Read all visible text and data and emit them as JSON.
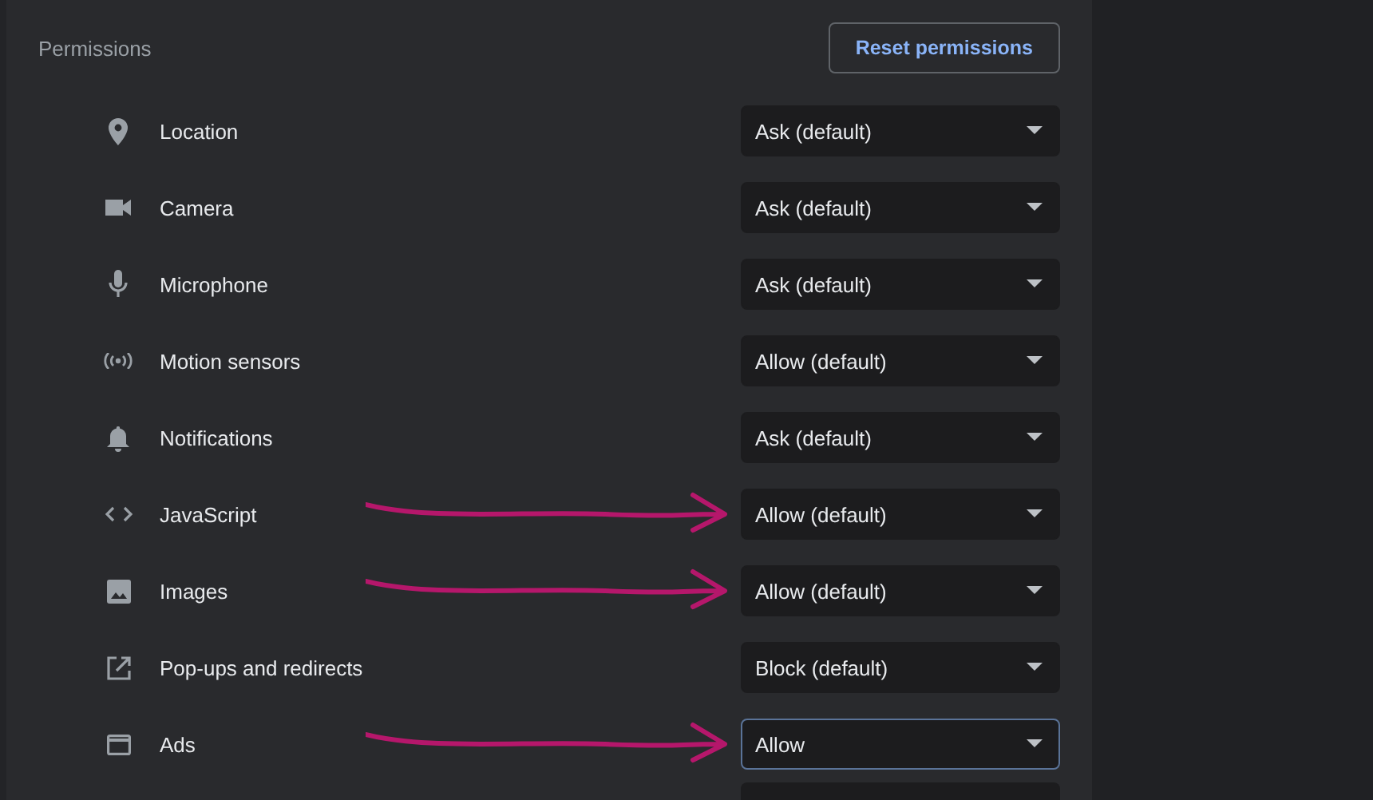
{
  "section": {
    "title": "Permissions",
    "reset_button": "Reset permissions"
  },
  "permissions": [
    {
      "label": "Location",
      "value": "Ask (default)",
      "focused": false,
      "arrow": false
    },
    {
      "label": "Camera",
      "value": "Ask (default)",
      "focused": false,
      "arrow": false
    },
    {
      "label": "Microphone",
      "value": "Ask (default)",
      "focused": false,
      "arrow": false
    },
    {
      "label": "Motion sensors",
      "value": "Allow (default)",
      "focused": false,
      "arrow": false
    },
    {
      "label": "Notifications",
      "value": "Ask (default)",
      "focused": false,
      "arrow": false
    },
    {
      "label": "JavaScript",
      "value": "Allow (default)",
      "focused": false,
      "arrow": true
    },
    {
      "label": "Images",
      "value": "Allow (default)",
      "focused": false,
      "arrow": true
    },
    {
      "label": "Pop-ups and redirects",
      "value": "Block (default)",
      "focused": false,
      "arrow": false
    },
    {
      "label": "Ads",
      "value": "Allow",
      "focused": true,
      "arrow": true
    }
  ]
}
